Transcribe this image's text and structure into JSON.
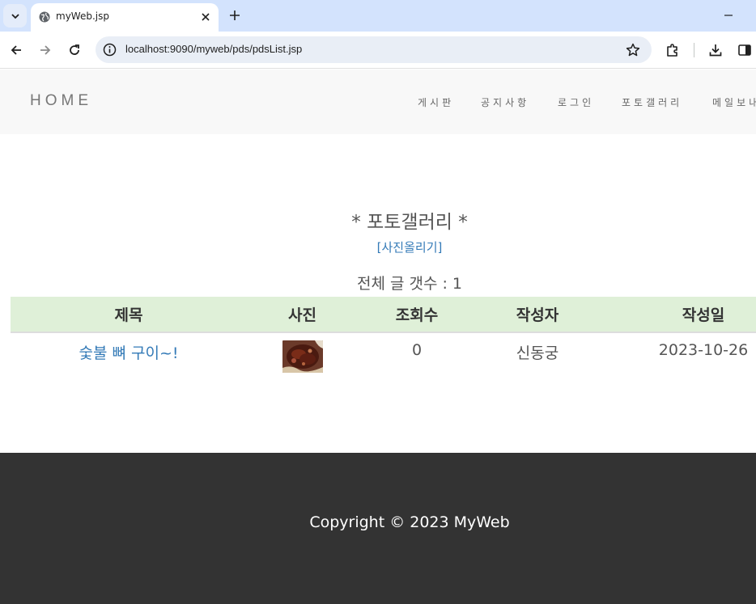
{
  "browser": {
    "tab_title": "myWeb.jsp",
    "url": "localhost:9090/myweb/pds/pdsList.jsp"
  },
  "header": {
    "brand": "HOME",
    "nav": [
      "게시판",
      "공지사항",
      "로그인",
      "포토갤러리",
      "메일보내"
    ]
  },
  "main": {
    "title": "* 포토갤러리 *",
    "upload_link": "[사진올리기]",
    "total_count": "전체 글 갯수 : 1",
    "table": {
      "headers": [
        "제목",
        "사진",
        "조회수",
        "작성자",
        "작성일"
      ],
      "rows": [
        {
          "title": "숯불 뼈 구이~!",
          "views": "0",
          "author": "신동궁",
          "date": "2023-10-26"
        }
      ]
    }
  },
  "footer": {
    "copyright": "Copyright © 2023 MyWeb"
  },
  "colors": {
    "tabstrip": "#d3e3fd",
    "header_bg": "#f8f8f8",
    "table_header_bg": "#dff0d8",
    "link": "#337ab7",
    "footer_bg": "#333333"
  }
}
